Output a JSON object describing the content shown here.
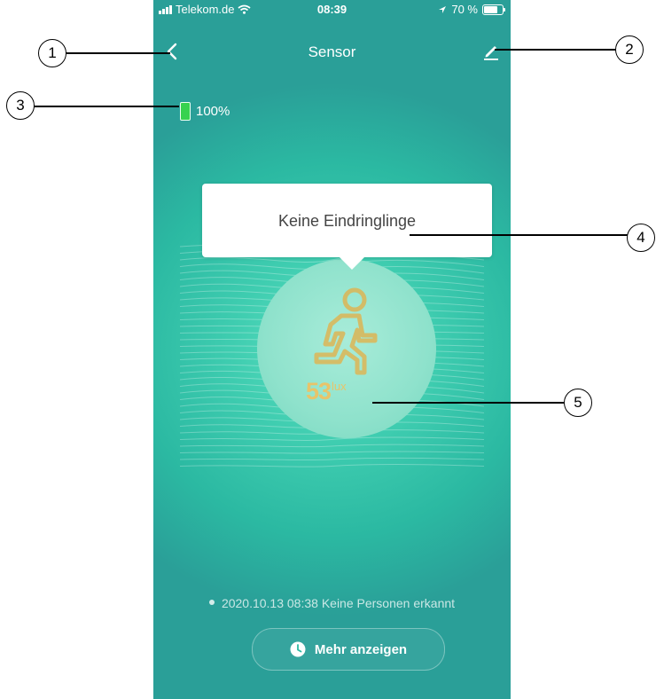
{
  "statusbar": {
    "carrier": "Telekom.de",
    "time": "08:39",
    "battery": "70 %"
  },
  "navbar": {
    "title": "Sensor",
    "back_icon": "chevron-left-icon",
    "edit_icon": "pencil-icon"
  },
  "device": {
    "battery_level": "100%"
  },
  "sensor": {
    "status_popup": "Keine Eindringlinge",
    "illuminance_value": "53",
    "illuminance_unit": "lux"
  },
  "log": {
    "latest_event": "2020.10.13 08:38 Keine Personen erkannt"
  },
  "actions": {
    "more_label": "Mehr anzeigen"
  },
  "callouts": [
    "1",
    "2",
    "3",
    "4",
    "5"
  ],
  "colors": {
    "background": "#2bb9a2",
    "accent_gold": "#e8c46a",
    "battery_green": "#37d24f"
  }
}
